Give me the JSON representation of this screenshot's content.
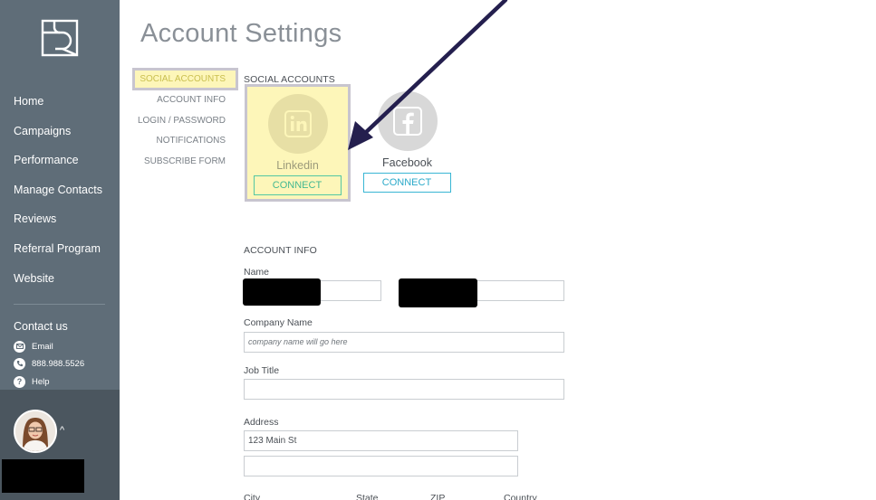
{
  "sidebar": {
    "nav": [
      {
        "label": "Home"
      },
      {
        "label": "Campaigns"
      },
      {
        "label": "Performance"
      },
      {
        "label": "Manage Contacts"
      },
      {
        "label": "Reviews"
      },
      {
        "label": "Referral Program"
      },
      {
        "label": "Website"
      }
    ],
    "contact": {
      "title": "Contact us",
      "email": "Email",
      "phone": "888.988.5526",
      "help": "Help"
    },
    "user_caret": "^"
  },
  "page": {
    "title": "Account Settings"
  },
  "subnav": [
    {
      "label": "SOCIAL ACCOUNTS",
      "active": true
    },
    {
      "label": "ACCOUNT INFO"
    },
    {
      "label": "LOGIN / PASSWORD"
    },
    {
      "label": "NOTIFICATIONS"
    },
    {
      "label": "SUBSCRIBE FORM"
    }
  ],
  "social": {
    "title": "SOCIAL ACCOUNTS",
    "accounts": [
      {
        "name": "Linkedin",
        "button": "CONNECT",
        "icon": "linkedin-icon"
      },
      {
        "name": "Facebook",
        "button": "CONNECT",
        "icon": "facebook-icon"
      }
    ]
  },
  "account_info": {
    "title": "ACCOUNT INFO",
    "name_label": "Name",
    "first_name": "",
    "last_name": "",
    "company_label": "Company Name",
    "company_placeholder": "company name will go here",
    "job_title_label": "Job Title",
    "job_title": "",
    "address_label": "Address",
    "address_line1": "123 Main St",
    "address_line2": "",
    "city_label": "City",
    "state_label": "State",
    "zip_label": "ZIP",
    "country_label": "Country"
  },
  "colors": {
    "sidebar": "#5f6d78",
    "sidebar_bottom": "#4b565f",
    "highlight": "#fdf6b9",
    "connect": "#2aa9c9",
    "arrow": "#241f4e"
  }
}
